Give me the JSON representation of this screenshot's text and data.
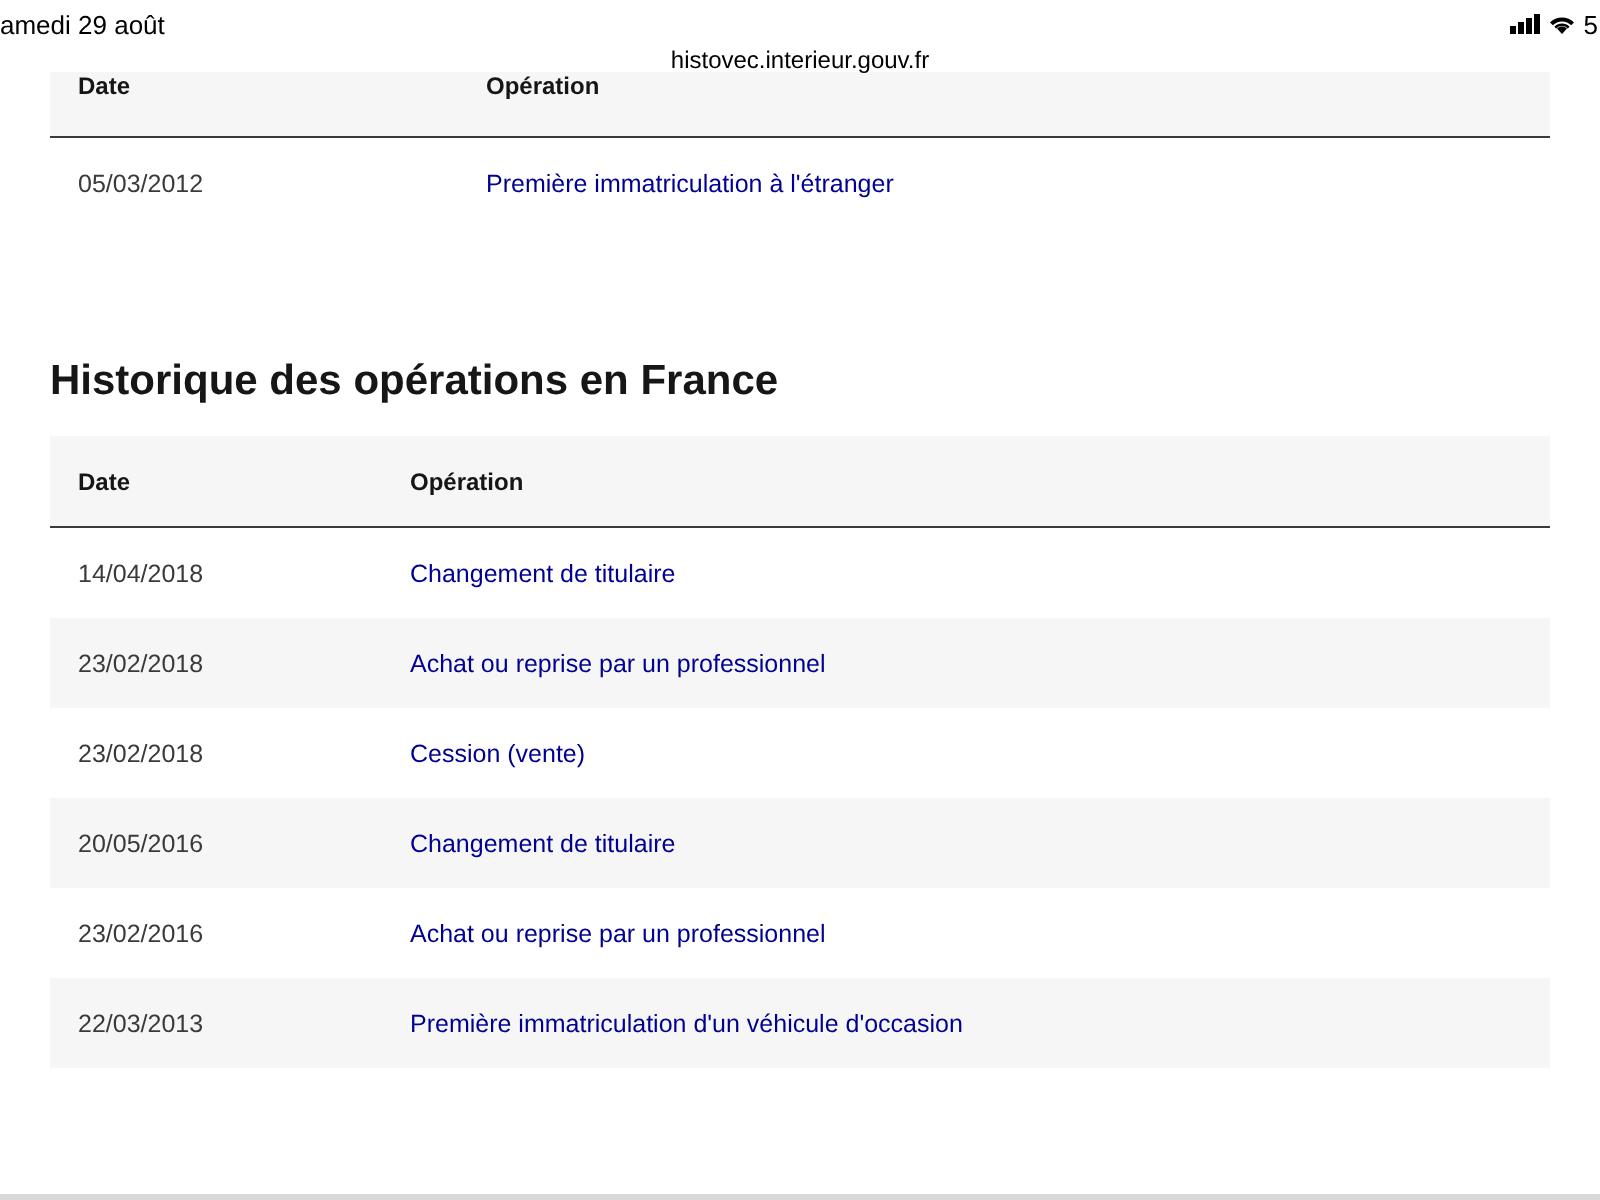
{
  "status_bar": {
    "date": "amedi 29 août",
    "battery": "5"
  },
  "url": "histovec.interieur.gouv.fr",
  "foreign_table": {
    "columns": [
      "Date",
      "Opération"
    ],
    "rows": [
      {
        "date": "05/03/2012",
        "operation": "Première immatriculation à l'étranger"
      }
    ]
  },
  "france_section": {
    "title": "Historique des opérations en France",
    "columns": [
      "Date",
      "Opération"
    ],
    "rows": [
      {
        "date": "14/04/2018",
        "operation": "Changement de titulaire"
      },
      {
        "date": "23/02/2018",
        "operation": "Achat ou reprise par un professionnel"
      },
      {
        "date": "23/02/2018",
        "operation": "Cession (vente)"
      },
      {
        "date": "20/05/2016",
        "operation": "Changement de titulaire"
      },
      {
        "date": "23/02/2016",
        "operation": "Achat ou reprise par un professionnel"
      },
      {
        "date": "22/03/2013",
        "operation": "Première immatriculation d'un véhicule d'occasion"
      }
    ]
  }
}
